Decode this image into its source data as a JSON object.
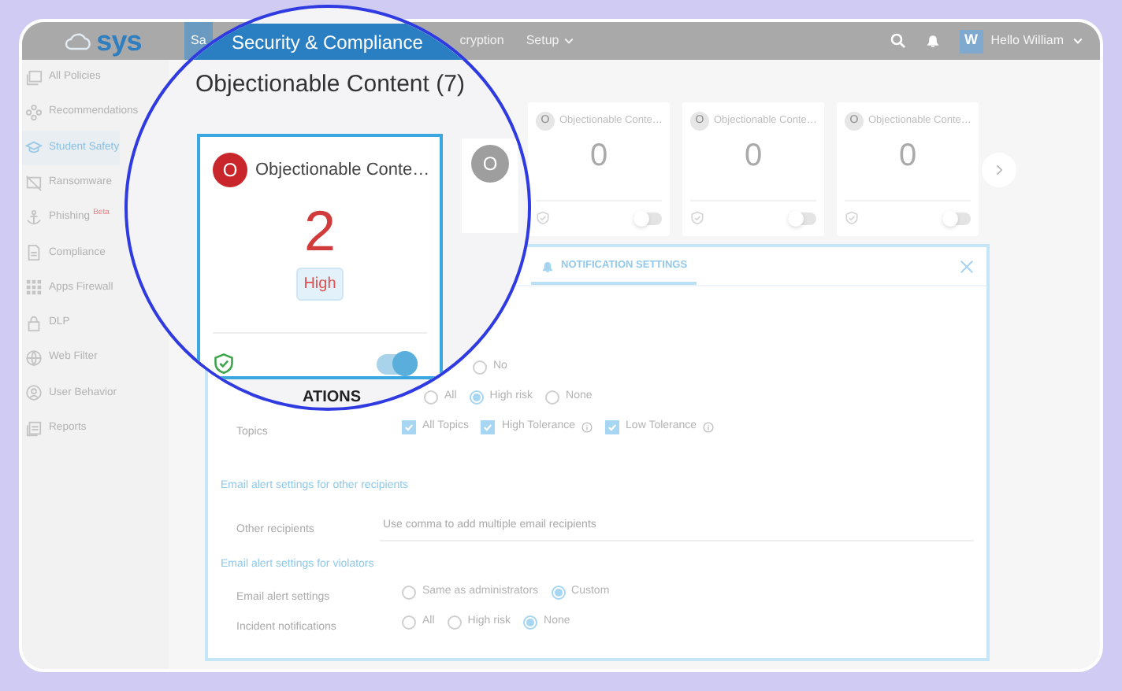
{
  "topbar": {
    "logo": "sys",
    "nav": [
      {
        "label": "Sa",
        "selected": true,
        "dropdown": false
      },
      {
        "label": "cryption",
        "selected": false,
        "dropdown": false
      },
      {
        "label": "Setup",
        "selected": false,
        "dropdown": true
      }
    ],
    "user": {
      "initial": "W",
      "greeting": "Hello William"
    }
  },
  "sidebar": {
    "items": [
      {
        "label": "All Policies",
        "selected": false
      },
      {
        "label": "Recommendations",
        "selected": false
      },
      {
        "label": "Student Safety",
        "selected": true
      },
      {
        "label": "Ransomware",
        "selected": false
      },
      {
        "label": "Phishing",
        "selected": false,
        "badge": "Beta"
      },
      {
        "label": "Compliance",
        "selected": false
      },
      {
        "label": "Apps Firewall",
        "selected": false
      },
      {
        "label": "DLP",
        "selected": false
      },
      {
        "label": "Web Filter",
        "selected": false
      },
      {
        "label": "User Behavior",
        "selected": false
      },
      {
        "label": "Reports",
        "selected": false
      }
    ]
  },
  "cards": [
    {
      "initial": "O",
      "title": "Objectionable Conte…",
      "count": "0",
      "enabled": false
    },
    {
      "initial": "O",
      "title": "Objectionable Conte…",
      "count": "0",
      "enabled": false
    },
    {
      "initial": "O",
      "title": "Objectionable Conte…",
      "count": "0",
      "enabled": false
    }
  ],
  "notification_panel": {
    "tab": "NOTIFICATION SETTINGS",
    "rows": [
      {
        "kind": "radio_tail",
        "options": [
          {
            "label": "No",
            "selected": false
          }
        ]
      },
      {
        "kind": "radio",
        "options": [
          {
            "label": "All",
            "selected": false
          },
          {
            "label": "High risk",
            "selected": true
          },
          {
            "label": "None",
            "selected": false
          }
        ]
      },
      {
        "kind": "checkbox",
        "label": "Topics",
        "options": [
          {
            "label": "All Topics",
            "checked": true,
            "info": false
          },
          {
            "label": "High Tolerance",
            "checked": true,
            "info": true
          },
          {
            "label": "Low Tolerance",
            "checked": true,
            "info": true
          }
        ]
      },
      {
        "kind": "heading",
        "label": "Email alert settings for other recipients"
      },
      {
        "kind": "input",
        "label": "Other recipients",
        "placeholder": "Use comma to add multiple email recipients"
      },
      {
        "kind": "heading",
        "label": "Email alert settings for violators"
      },
      {
        "kind": "radio",
        "label": "Email alert settings",
        "options": [
          {
            "label": "Same as administrators",
            "selected": false
          },
          {
            "label": "Custom",
            "selected": true
          }
        ]
      },
      {
        "kind": "radio",
        "label": "Incident notifications",
        "options": [
          {
            "label": "All",
            "selected": false
          },
          {
            "label": "High risk",
            "selected": false
          },
          {
            "label": "None",
            "selected": true
          }
        ]
      }
    ]
  },
  "magnifier": {
    "menu_label": "Security & Compliance",
    "heading": "Objectionable Content (7)",
    "card": {
      "initial": "O",
      "title": "Objectionable Conte…",
      "count": "2",
      "severity": "High",
      "enabled": true
    },
    "next_card": {
      "initial": "O"
    },
    "section_fragment": "ATIONS"
  }
}
